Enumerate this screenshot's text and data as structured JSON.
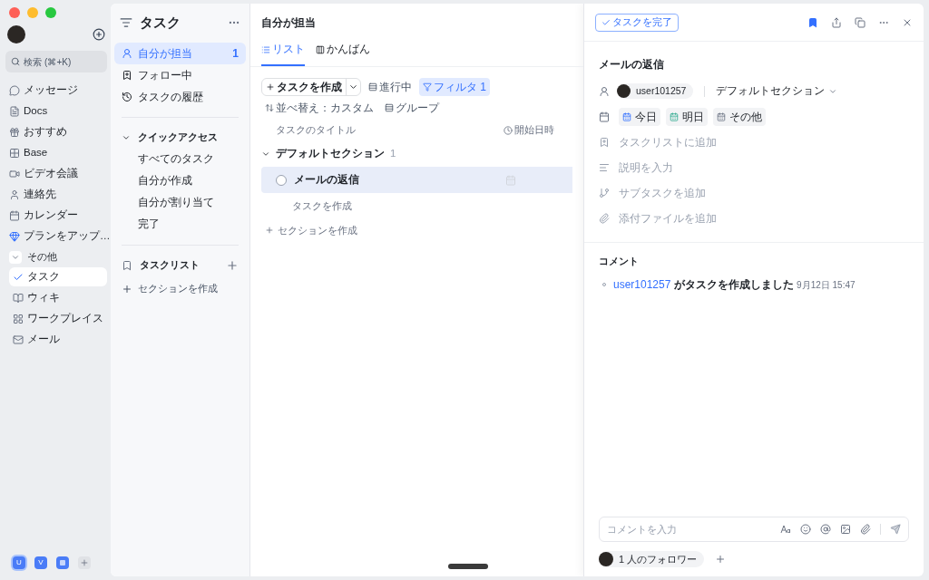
{
  "sidebar": {
    "search": {
      "placeholder": "検索 (⌘+K)"
    },
    "items": [
      {
        "label": "メッセージ",
        "selected": false
      },
      {
        "label": "Docs",
        "selected": false
      },
      {
        "label": "おすすめ",
        "selected": false
      },
      {
        "label": "Base",
        "selected": false
      },
      {
        "label": "ビデオ会議",
        "selected": false
      },
      {
        "label": "連絡先",
        "selected": false
      },
      {
        "label": "カレンダー",
        "selected": false
      },
      {
        "label": "プランをアップ…",
        "selected": false
      }
    ],
    "group": {
      "label": "その他",
      "expanded": true,
      "children": [
        {
          "label": "タスク",
          "selected": true
        },
        {
          "label": "ウィキ",
          "selected": false
        },
        {
          "label": "ワークプレイス",
          "selected": false
        },
        {
          "label": "メール",
          "selected": false
        }
      ]
    },
    "workspaces": [
      {
        "label": "U",
        "selected": true
      },
      {
        "label": "V",
        "selected": false
      },
      {
        "selected": false
      }
    ]
  },
  "tasks_panel": {
    "title": "タスク",
    "nav": [
      {
        "label": "自分が担当",
        "count": "1",
        "selected": true
      },
      {
        "label": "フォロー中",
        "selected": false
      },
      {
        "label": "タスクの履歴",
        "selected": false
      }
    ],
    "quick_access": {
      "label": "クイックアクセス",
      "expanded": true,
      "items": [
        "すべてのタスク",
        "自分が作成",
        "自分が割り当て",
        "完了"
      ]
    },
    "tasklist": {
      "label": "タスクリスト"
    },
    "create_section": "セクションを作成"
  },
  "main": {
    "title": "自分が担当",
    "tabs": [
      {
        "label": "リスト",
        "selected": true
      },
      {
        "label": "かんばん",
        "selected": false
      }
    ],
    "toolbar": {
      "create": "タスクを作成",
      "in_progress": "進行中",
      "filter": {
        "label": "フィルタ 1",
        "active": true
      },
      "sort": "並べ替え：カスタム",
      "group": "グループ"
    },
    "columns": [
      "タスクのタイトル",
      "開始日時"
    ],
    "sections": [
      {
        "name": "デフォルトセクション",
        "count": "1",
        "expanded": true,
        "tasks": [
          {
            "title": "メールの返信",
            "selected": true
          }
        ],
        "create_task": "タスクを作成"
      }
    ],
    "create_section": "セクションを作成"
  },
  "detail": {
    "complete_button": "タスクを完了",
    "title": "メールの返信",
    "assignee": "user101257",
    "section": "デフォルトセクション",
    "dates": [
      "今日",
      "明日",
      "その他"
    ],
    "fields": [
      "タスクリストに追加",
      "説明を入力",
      "サブタスクを追加",
      "添付ファイルを追加"
    ],
    "comments": {
      "title": "コメント",
      "activity": [
        {
          "user": "user101257",
          "text": "がタスクを作成しました",
          "time": "9月12日 15:47"
        }
      ]
    },
    "comment_input": {
      "placeholder": "コメントを入力"
    },
    "followers": "1 人のフォロワー"
  }
}
